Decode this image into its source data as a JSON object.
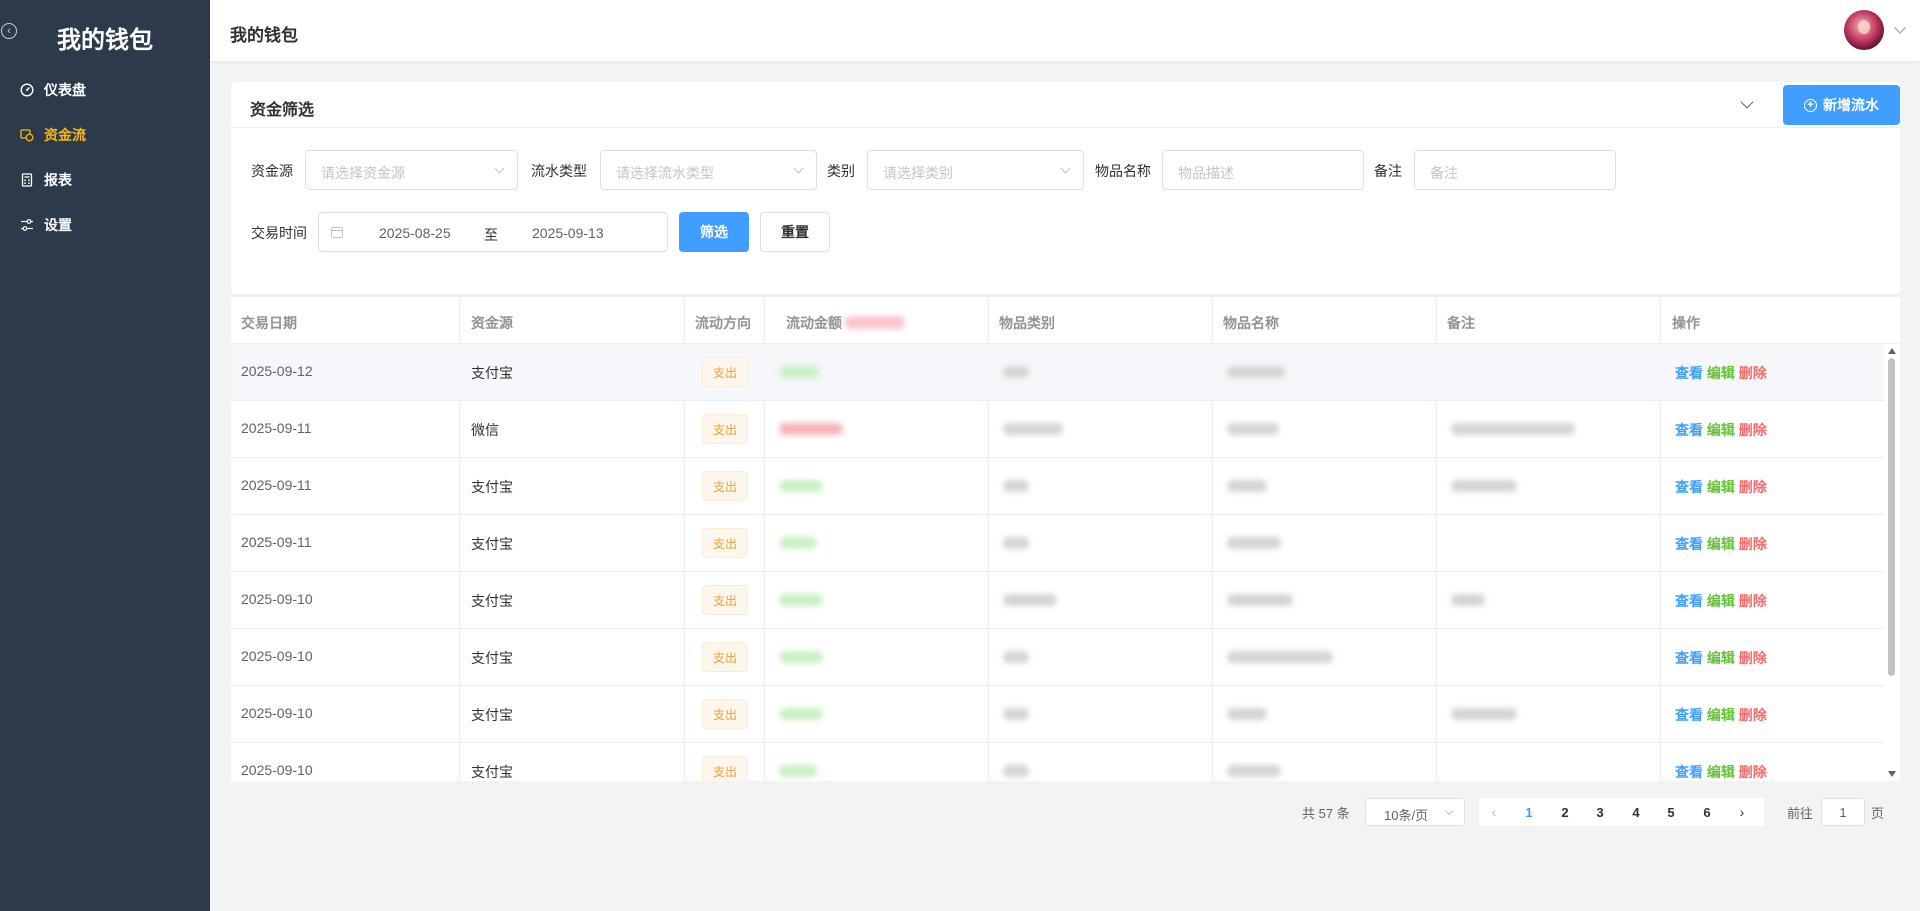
{
  "sidebar": {
    "title": "我的钱包",
    "items": [
      {
        "label": "仪表盘",
        "icon": "dashboard-icon"
      },
      {
        "label": "资金流",
        "icon": "money-flow-icon",
        "active": true
      },
      {
        "label": "报表",
        "icon": "calculator-icon"
      },
      {
        "label": "设置",
        "icon": "sliders-icon"
      }
    ]
  },
  "header": {
    "title": "我的钱包"
  },
  "filter": {
    "title": "资金筛选",
    "add_button": "新增流水",
    "source_label": "资金源",
    "source_placeholder": "请选择资金源",
    "flow_type_label": "流水类型",
    "flow_type_placeholder": "请选择流水类型",
    "category_label": "类别",
    "category_placeholder": "请选择类别",
    "item_name_label": "物品名称",
    "item_name_placeholder": "物品描述",
    "remark_label": "备注",
    "remark_placeholder": "备注",
    "date_label": "交易时间",
    "date_start": "2025-08-25",
    "date_sep": "至",
    "date_end": "2025-09-13",
    "filter_button": "筛选",
    "reset_button": "重置"
  },
  "table": {
    "columns": [
      "交易日期",
      "资金源",
      "流动方向",
      "流动金额",
      "物品类别",
      "物品名称",
      "备注",
      "操作"
    ],
    "rows": [
      {
        "date": "2025-09-12",
        "source": "支付宝",
        "direction": "支出"
      },
      {
        "date": "2025-09-11",
        "source": "微信",
        "direction": "支出"
      },
      {
        "date": "2025-09-11",
        "source": "支付宝",
        "direction": "支出"
      },
      {
        "date": "2025-09-11",
        "source": "支付宝",
        "direction": "支出"
      },
      {
        "date": "2025-09-10",
        "source": "支付宝",
        "direction": "支出"
      },
      {
        "date": "2025-09-10",
        "source": "支付宝",
        "direction": "支出"
      },
      {
        "date": "2025-09-10",
        "source": "支付宝",
        "direction": "支出"
      },
      {
        "date": "2025-09-10",
        "source": "支付宝",
        "direction": "支出"
      }
    ],
    "ops": {
      "view": "查看",
      "edit": "编辑",
      "delete": "删除"
    }
  },
  "pagination": {
    "total": "共 57 条",
    "page_size": "10条/页",
    "pages": [
      "1",
      "2",
      "3",
      "4",
      "5",
      "6"
    ],
    "current": "1",
    "goto_label": "前往",
    "goto_value": "1",
    "page_label": "页"
  },
  "colors": {
    "sidebar_bg": "#2d3a4b",
    "active_menu": "#f5b719",
    "primary": "#409eff",
    "success": "#67c23a",
    "danger": "#f56c6c",
    "warning": "#e6a23c"
  }
}
